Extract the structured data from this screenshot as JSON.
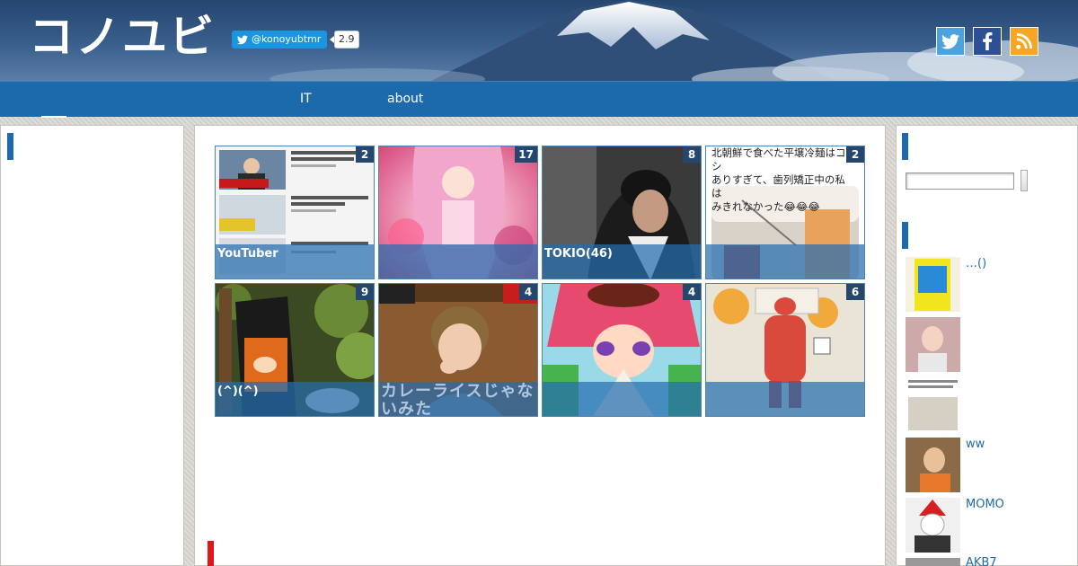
{
  "header": {
    "logo_text": "コノユビ",
    "twitter_follow": "@konoyubtmr",
    "twitter_count": "2.9",
    "social": [
      {
        "name": "twitter",
        "icon": "twitter-icon"
      },
      {
        "name": "facebook",
        "icon": "facebook-icon"
      },
      {
        "name": "rss",
        "icon": "rss-icon"
      }
    ]
  },
  "nav": {
    "items": [
      {
        "label": ""
      },
      {
        "label": "IT"
      },
      {
        "label": "about"
      }
    ]
  },
  "tiles": [
    {
      "label": "YouTuber",
      "count": "2",
      "thumb_text": [
        "ビビットで山口達也メンバー",
        "数で国分太一さん涙の謝罪",
        "涙の謝罪",
        "賞味期限が切れたキムチを食べた結果",
        "大惨事",
        "ローソンのゴディバショコラパ"
      ]
    },
    {
      "label": "",
      "count": "17"
    },
    {
      "label": "TOKIO(46)",
      "count": "8"
    },
    {
      "label": "",
      "count": "2",
      "thumb_text": [
        "北朝鮮で食べた平壌冷麺はコシ",
        "ありすぎて、歯列矯正中の私は",
        "みきれなかった😂😂😂"
      ]
    },
    {
      "label": "(^)(^)",
      "count": "9"
    },
    {
      "label": "",
      "count": "4",
      "thumb_text": [
        "カレーライスじゃないみた"
      ]
    },
    {
      "label": "",
      "count": "4"
    },
    {
      "label": "",
      "count": "6"
    }
  ],
  "sidebar": {
    "links": [
      {
        "label": "…()"
      },
      {
        "label": ""
      },
      {
        "label": ""
      },
      {
        "label": "ww"
      },
      {
        "label": "MOMO"
      },
      {
        "label": "AKB7"
      }
    ]
  },
  "colors": {
    "nav": "#1c69ab",
    "tile_overlay": "#266eaf",
    "badge": "#25466d",
    "accent_red": "#e0161b"
  }
}
